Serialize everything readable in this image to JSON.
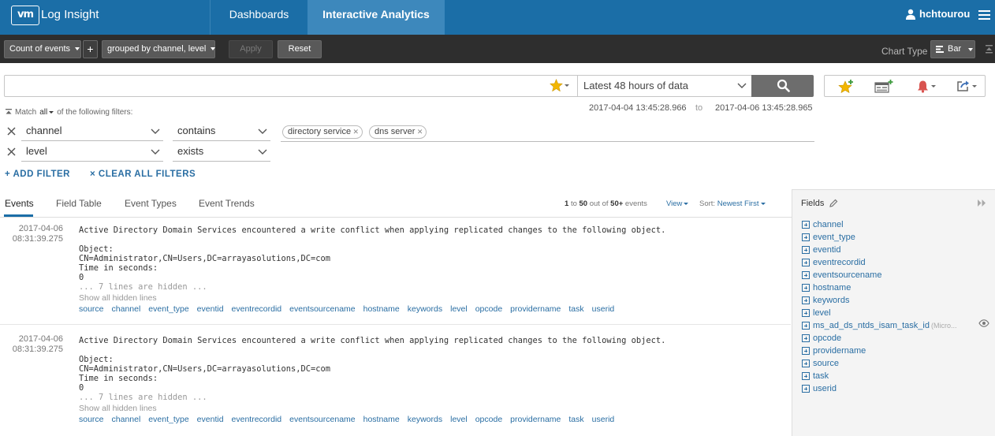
{
  "header": {
    "logo_text": "vm",
    "app_name": "Log Insight",
    "tabs": [
      "Dashboards",
      "Interactive Analytics"
    ],
    "active_tab": "Interactive Analytics",
    "username": "hchtourou"
  },
  "toolbar": {
    "aggregate": "Count of events",
    "add": "+",
    "group_by": "grouped by channel, level",
    "apply": "Apply",
    "reset": "Reset",
    "chart_type_label": "Chart Type",
    "chart_type_value": "Bar"
  },
  "search": {
    "query": "",
    "time_range": "Latest 48 hours of data"
  },
  "filters": {
    "match_prefix": "Match",
    "match_value": "all",
    "match_suffix": "of the following filters:",
    "date_from": "2017-04-04  13:45:28.966",
    "date_to_label": "to",
    "date_to": "2017-04-06  13:45:28.965",
    "rows": [
      {
        "field": "channel",
        "operator": "contains",
        "values": [
          "directory service",
          "dns server"
        ]
      },
      {
        "field": "level",
        "operator": "exists",
        "values": []
      }
    ],
    "add_filter": "+ ADD FILTER",
    "clear_filters": "× CLEAR ALL FILTERS"
  },
  "tabs": [
    "Events",
    "Field Table",
    "Event Types",
    "Event Trends"
  ],
  "active_tab": "Events",
  "event_count": {
    "from": "1",
    "to_word": "to",
    "to": "50",
    "out_of": "out of",
    "total": "50+",
    "suffix": "events"
  },
  "view_label": "View",
  "sort": {
    "label": "Sort:",
    "value": "Newest First"
  },
  "events": [
    {
      "date": "2017-04-06",
      "time": "08:31:39.275",
      "message": "Active Directory Domain Services encountered a write conflict when applying replicated changes to the following object.\n\nObject:\nCN=Administrator,CN=Users,DC=arrayasolutions,DC=com\nTime in seconds:\n0",
      "hidden": "... 7 lines are hidden ...",
      "show_hidden": "Show all hidden lines",
      "fields": [
        "source",
        "channel",
        "event_type",
        "eventid",
        "eventrecordid",
        "eventsourcename",
        "hostname",
        "keywords",
        "level",
        "opcode",
        "providername",
        "task",
        "userid"
      ]
    },
    {
      "date": "2017-04-06",
      "time": "08:31:39.275",
      "message": "Active Directory Domain Services encountered a write conflict when applying replicated changes to the following object.\n\nObject:\nCN=Administrator,CN=Users,DC=arrayasolutions,DC=com\nTime in seconds:\n0",
      "hidden": "... 7 lines are hidden ...",
      "show_hidden": "Show all hidden lines",
      "fields": [
        "source",
        "channel",
        "event_type",
        "eventid",
        "eventrecordid",
        "eventsourcename",
        "hostname",
        "keywords",
        "level",
        "opcode",
        "providername",
        "task",
        "userid"
      ]
    }
  ],
  "fields_panel": {
    "title": "Fields",
    "items": [
      {
        "name": "channel"
      },
      {
        "name": "event_type"
      },
      {
        "name": "eventid"
      },
      {
        "name": "eventrecordid"
      },
      {
        "name": "eventsourcename"
      },
      {
        "name": "hostname"
      },
      {
        "name": "keywords"
      },
      {
        "name": "level"
      },
      {
        "name": "ms_ad_ds_ntds_isam_task_id",
        "note": "(Micro..."
      },
      {
        "name": "opcode"
      },
      {
        "name": "providername"
      },
      {
        "name": "source"
      },
      {
        "name": "task"
      },
      {
        "name": "userid"
      }
    ]
  },
  "colors": {
    "nav_bg": "#1b6ea7",
    "nav_active": "#3d88bc",
    "toolbar_bg": "#2e2e2e",
    "link": "#2a6ea3",
    "star": "#f2b600",
    "alert": "#d9534f",
    "add_green": "#3c9a3c"
  },
  "icons": [
    "user-icon",
    "hamburger-menu-icon",
    "favorite-star-icon",
    "search-icon",
    "add-to-favorites-icon",
    "add-to-dashboard-icon",
    "alert-bell-icon",
    "export-icon",
    "remove-filter-icon",
    "edit-pencil-icon",
    "collapse-panel-icon",
    "eye-icon"
  ]
}
